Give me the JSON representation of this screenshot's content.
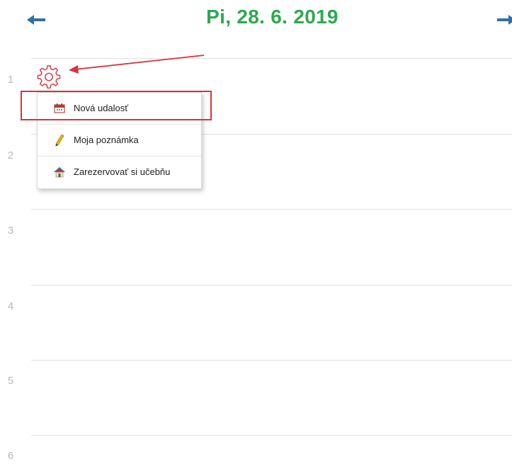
{
  "header": {
    "date": "Pi, 28. 6. 2019",
    "date_color": "#2fa84f",
    "arrow_color": "#2e6fa8",
    "prev_icon": "arrow-left-icon",
    "next_icon": "arrow-right-icon"
  },
  "slots": [
    "1",
    "2",
    "3",
    "4",
    "5",
    "6"
  ],
  "settings_icon": "gear-icon",
  "context_menu": {
    "items": [
      {
        "label": "Nová udalosť",
        "icon": "calendar-icon"
      },
      {
        "label": "Moja poznámka",
        "icon": "pencil-icon"
      },
      {
        "label": "Zarezervovať si učebňu",
        "icon": "house-icon"
      }
    ]
  },
  "annotation": {
    "color": "#d9333a",
    "highlighted_item": "Nová udalosť"
  }
}
